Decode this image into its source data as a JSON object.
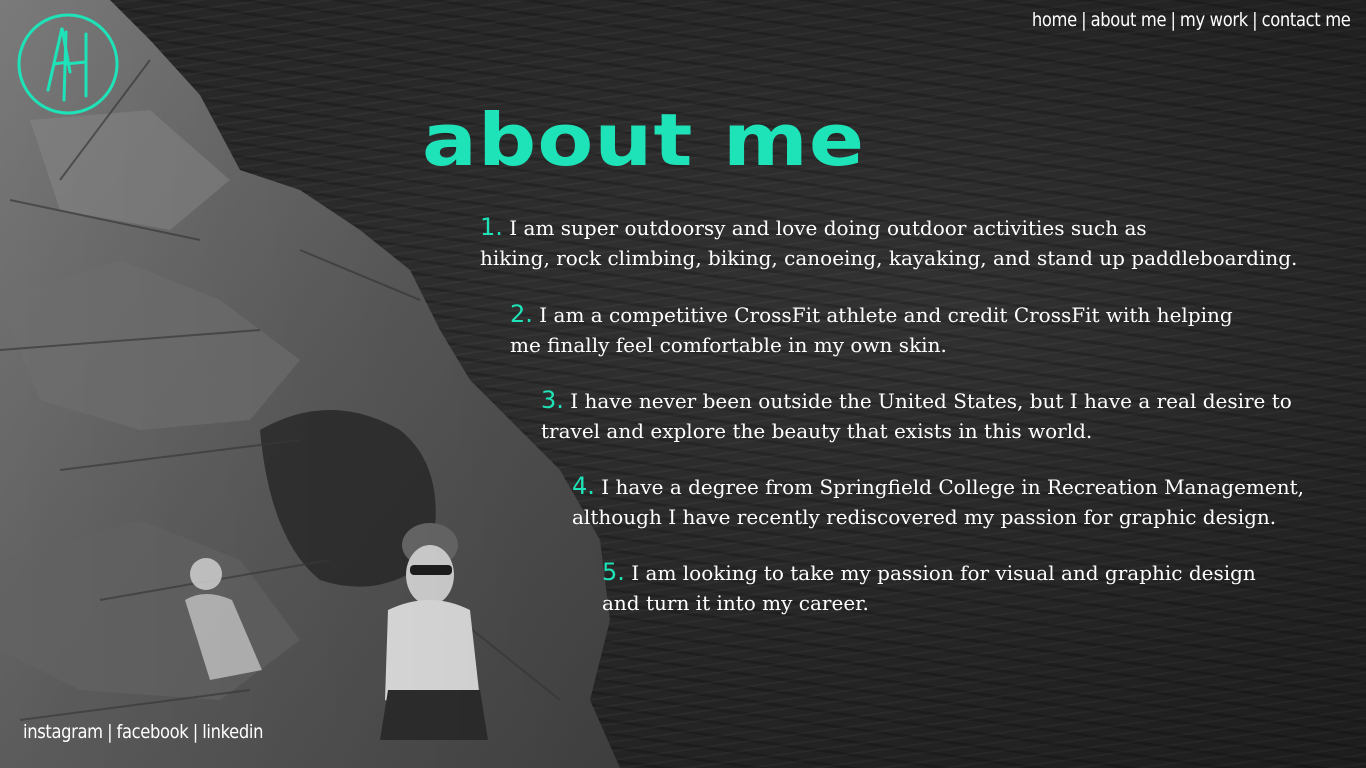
{
  "logo": {
    "monogram": "AH",
    "color": "#1fe3b8"
  },
  "nav": {
    "items": [
      "home",
      "about me",
      "my work",
      "contact me"
    ],
    "separator": "|"
  },
  "title": "about me",
  "accent_color": "#1fe3b8",
  "facts": [
    {
      "number": "1.",
      "line1": "I am super outdoorsy and love doing outdoor activities such as",
      "line2": "hiking, rock climbing, biking, canoeing, kayaking, and stand up paddleboarding."
    },
    {
      "number": "2.",
      "line1": "I am a competitive CrossFit athlete and credit CrossFit with helping",
      "line2": "me finally feel comfortable in my own skin."
    },
    {
      "number": "3.",
      "line1": "I have never been outside the United States, but I have a real desire to",
      "line2": "travel and explore the beauty that exists in this world."
    },
    {
      "number": "4.",
      "line1": "I have a degree from Springfield College in Recreation Management,",
      "line2": "although I have recently rediscovered my passion for graphic design."
    },
    {
      "number": "5.",
      "line1": "I am looking to take my passion for visual and graphic design",
      "line2": "and turn it into my career."
    }
  ],
  "social": {
    "items": [
      "instagram",
      "facebook",
      "linkedin"
    ],
    "separator": "|"
  }
}
